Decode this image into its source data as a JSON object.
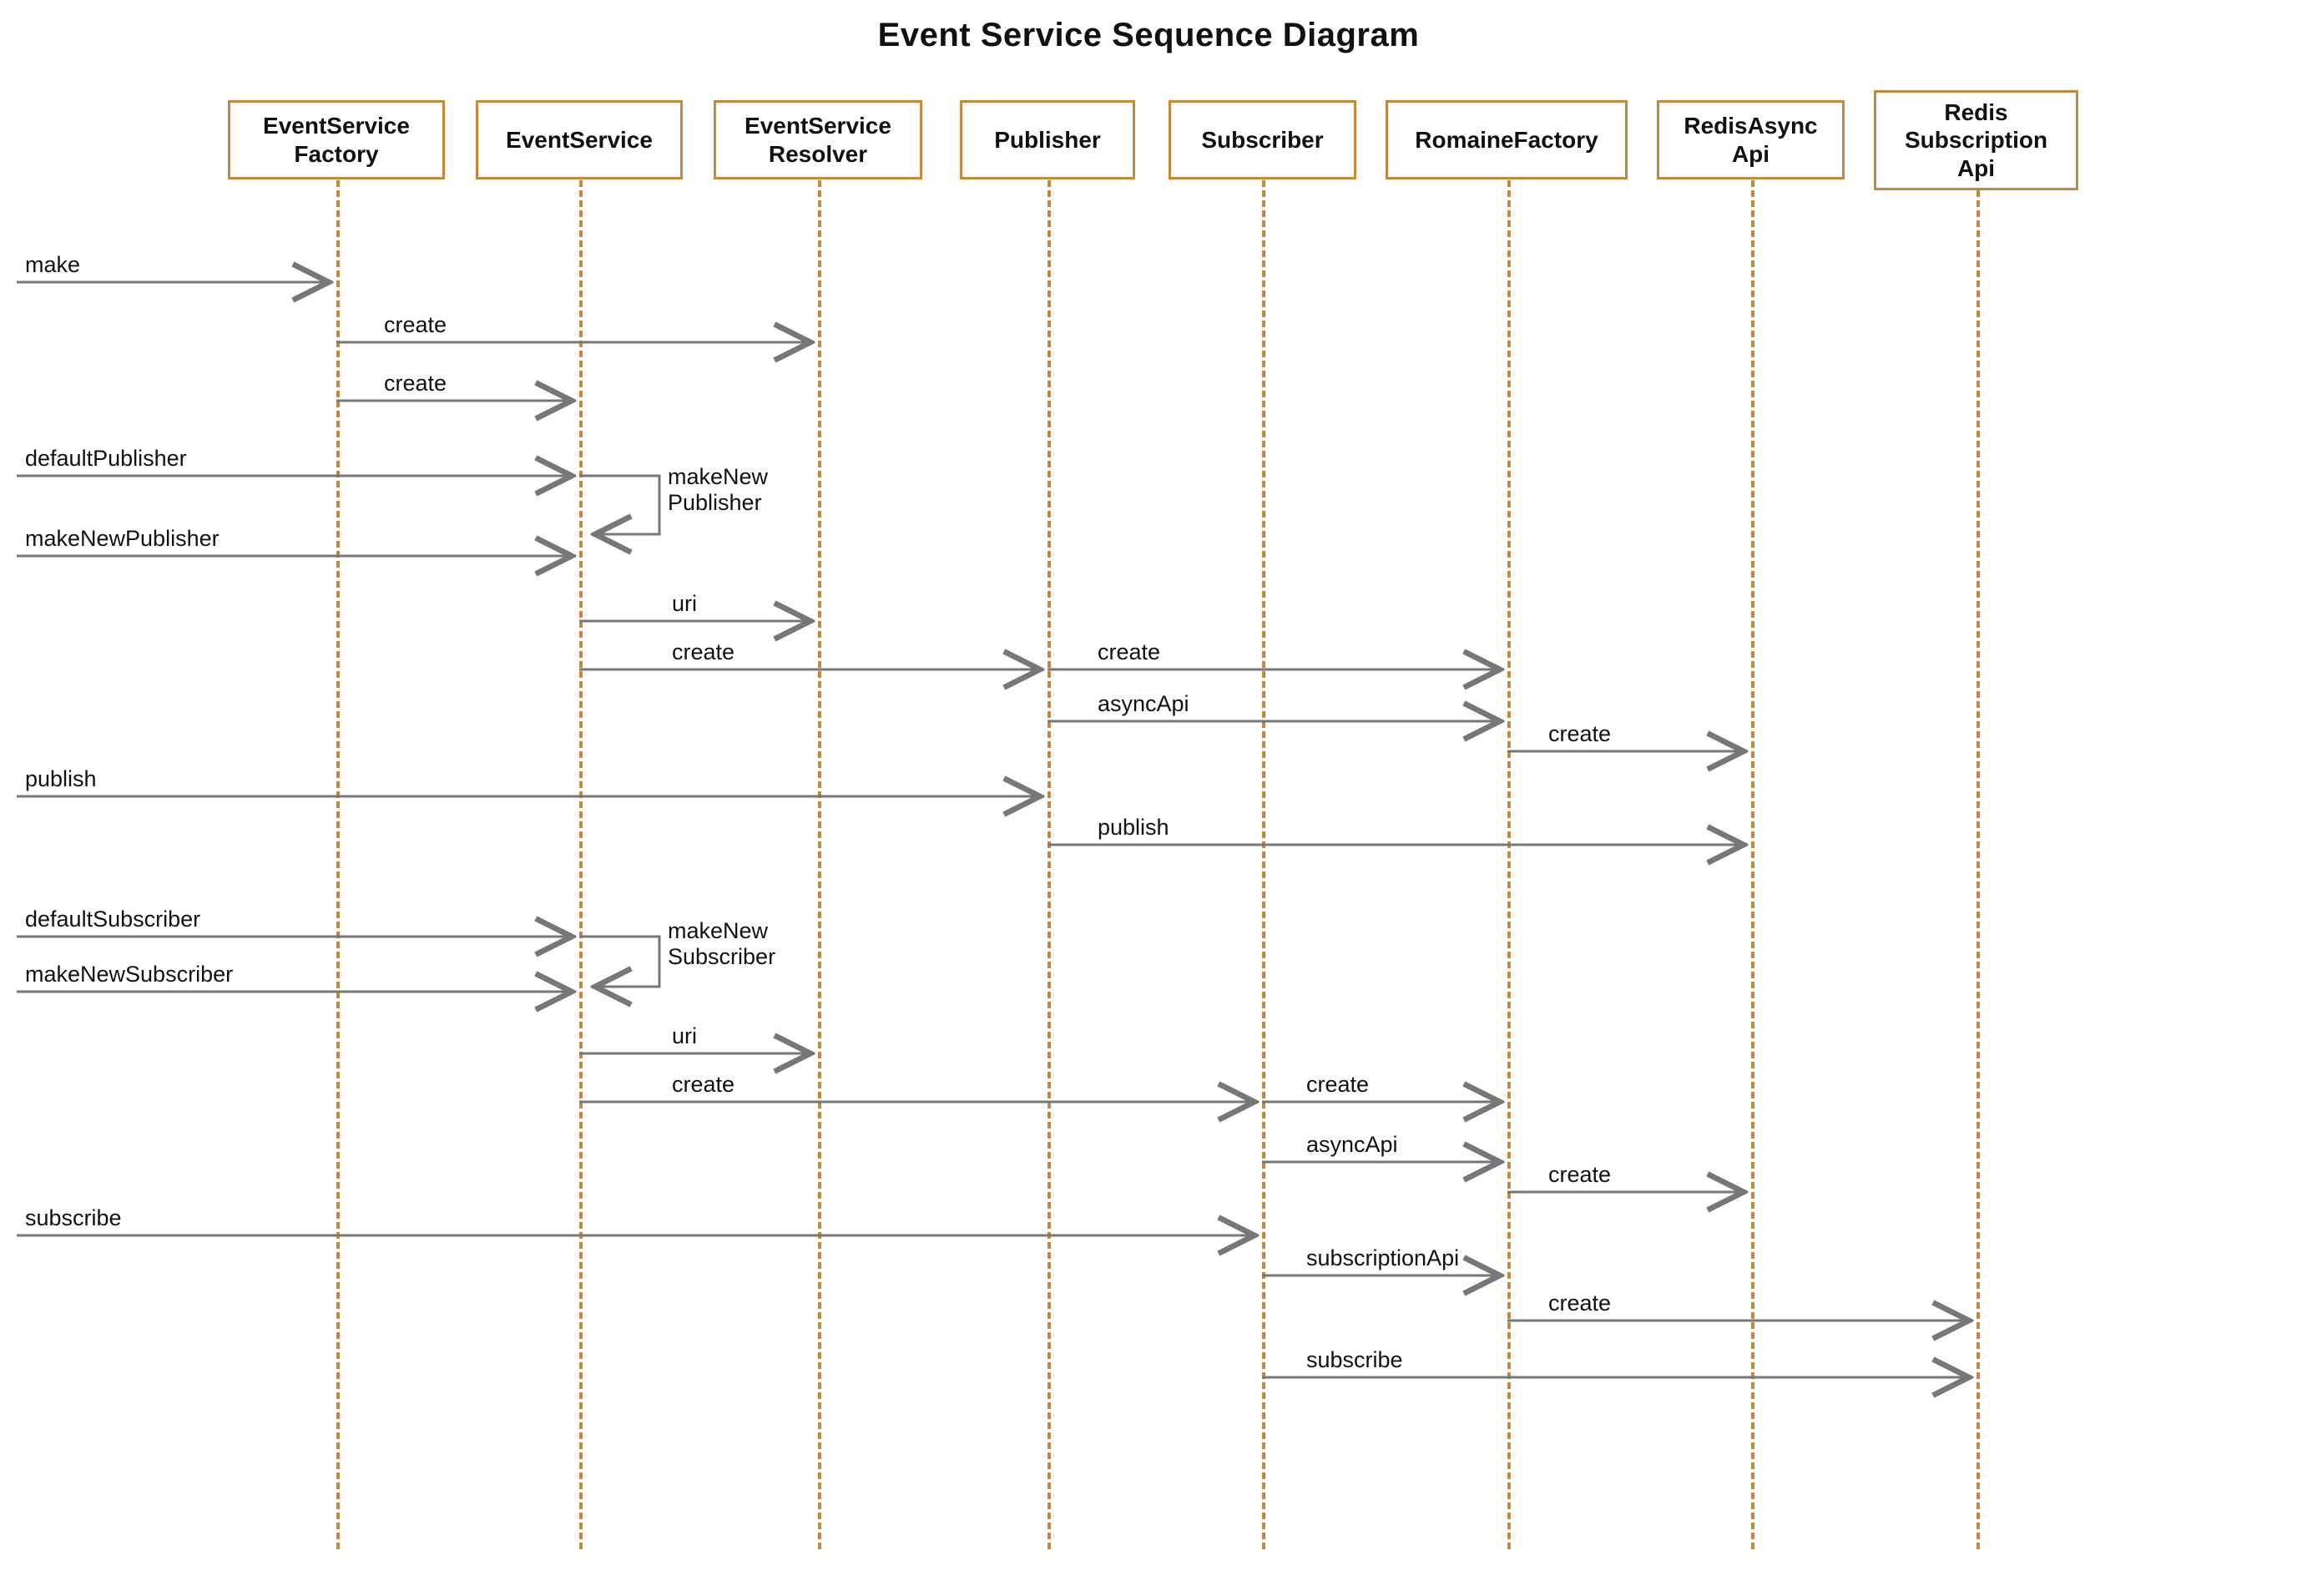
{
  "title": "Event Service Sequence Diagram",
  "participants": [
    {
      "id": "p0",
      "label": "EventService\nFactory"
    },
    {
      "id": "p1",
      "label": "EventService"
    },
    {
      "id": "p2",
      "label": "EventService\nResolver"
    },
    {
      "id": "p3",
      "label": "Publisher"
    },
    {
      "id": "p4",
      "label": "Subscriber"
    },
    {
      "id": "p5",
      "label": "RomaineFactory"
    },
    {
      "id": "p6",
      "label": "RedisAsync\nApi"
    },
    {
      "id": "p7",
      "label": "Redis\nSubscription\nApi"
    }
  ],
  "messages": [
    {
      "id": "m0",
      "label": "make"
    },
    {
      "id": "m1",
      "label": "create"
    },
    {
      "id": "m2",
      "label": "create"
    },
    {
      "id": "m3",
      "label": "defaultPublisher"
    },
    {
      "id": "m4",
      "label": "makeNew\nPublisher"
    },
    {
      "id": "m5",
      "label": "makeNewPublisher"
    },
    {
      "id": "m6",
      "label": "uri"
    },
    {
      "id": "m7",
      "label": "create"
    },
    {
      "id": "m8",
      "label": "create"
    },
    {
      "id": "m9",
      "label": "asyncApi"
    },
    {
      "id": "m10",
      "label": "create"
    },
    {
      "id": "m11",
      "label": "publish"
    },
    {
      "id": "m12",
      "label": "publish"
    },
    {
      "id": "m13",
      "label": "defaultSubscriber"
    },
    {
      "id": "m14",
      "label": "makeNew\nSubscriber"
    },
    {
      "id": "m15",
      "label": "makeNewSubscriber"
    },
    {
      "id": "m16",
      "label": "uri"
    },
    {
      "id": "m17",
      "label": "create"
    },
    {
      "id": "m18",
      "label": "create"
    },
    {
      "id": "m19",
      "label": "asyncApi"
    },
    {
      "id": "m20",
      "label": "create"
    },
    {
      "id": "m21",
      "label": "subscribe"
    },
    {
      "id": "m22",
      "label": "subscriptionApi"
    },
    {
      "id": "m23",
      "label": "create"
    },
    {
      "id": "m24",
      "label": "subscribe"
    }
  ]
}
